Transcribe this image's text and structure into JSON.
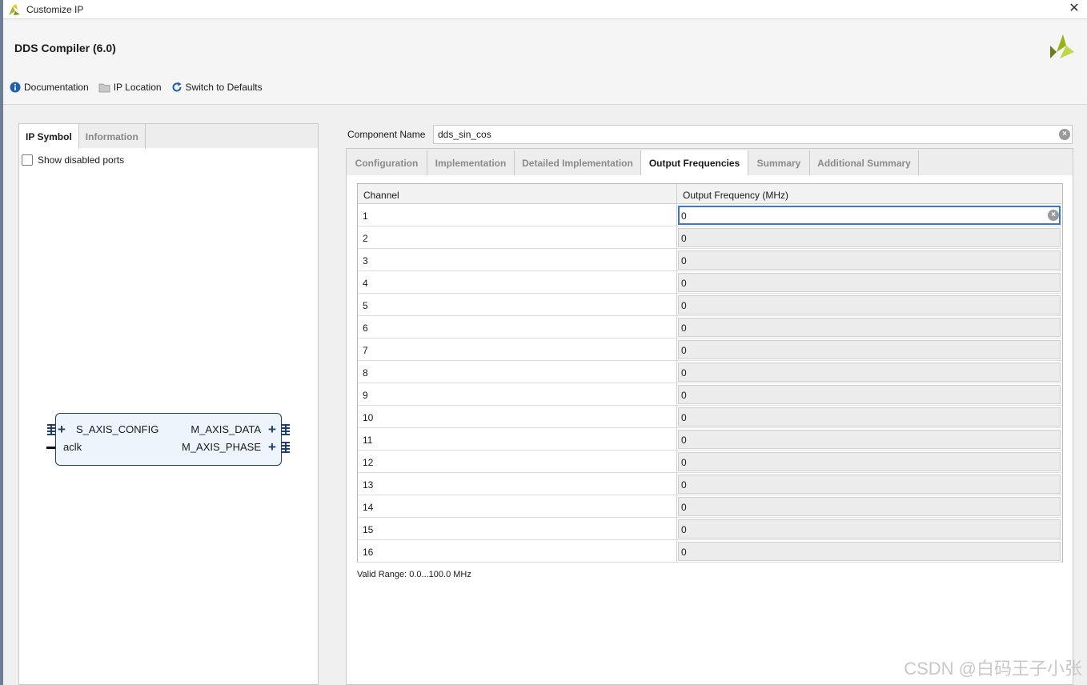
{
  "window": {
    "title": "Customize IP"
  },
  "header": {
    "ip_title": "DDS Compiler (6.0)"
  },
  "toolbar": {
    "documentation": "Documentation",
    "ip_location": "IP Location",
    "switch_defaults": "Switch to Defaults"
  },
  "left_panel": {
    "tabs": [
      {
        "label": "IP Symbol",
        "active": true
      },
      {
        "label": "Information",
        "active": false
      }
    ],
    "show_disabled_ports": "Show disabled ports",
    "symbol": {
      "left_ports": [
        "S_AXIS_CONFIG",
        "aclk"
      ],
      "right_ports": [
        "M_AXIS_DATA",
        "M_AXIS_PHASE"
      ]
    }
  },
  "component": {
    "label": "Component Name",
    "value": "dds_sin_cos"
  },
  "right_tabs": [
    {
      "label": "Configuration",
      "active": false
    },
    {
      "label": "Implementation",
      "active": false
    },
    {
      "label": "Detailed Implementation",
      "active": false
    },
    {
      "label": "Output Frequencies",
      "active": true
    },
    {
      "label": "Summary",
      "active": false
    },
    {
      "label": "Additional Summary",
      "active": false
    }
  ],
  "freq_table": {
    "headers": [
      "Channel",
      "Output Frequency (MHz)"
    ],
    "rows": [
      {
        "channel": "1",
        "value": "0"
      },
      {
        "channel": "2",
        "value": "0"
      },
      {
        "channel": "3",
        "value": "0"
      },
      {
        "channel": "4",
        "value": "0"
      },
      {
        "channel": "5",
        "value": "0"
      },
      {
        "channel": "6",
        "value": "0"
      },
      {
        "channel": "7",
        "value": "0"
      },
      {
        "channel": "8",
        "value": "0"
      },
      {
        "channel": "9",
        "value": "0"
      },
      {
        "channel": "10",
        "value": "0"
      },
      {
        "channel": "11",
        "value": "0"
      },
      {
        "channel": "12",
        "value": "0"
      },
      {
        "channel": "13",
        "value": "0"
      },
      {
        "channel": "14",
        "value": "0"
      },
      {
        "channel": "15",
        "value": "0"
      },
      {
        "channel": "16",
        "value": "0"
      }
    ],
    "valid_range": "Valid Range: 0.0...100.0 MHz"
  },
  "watermark": "CSDN @白码王子小张",
  "colors": {
    "accent": "#3a78c9",
    "symbol_border": "#1f3f66",
    "symbol_fill": "#eef4fb"
  }
}
